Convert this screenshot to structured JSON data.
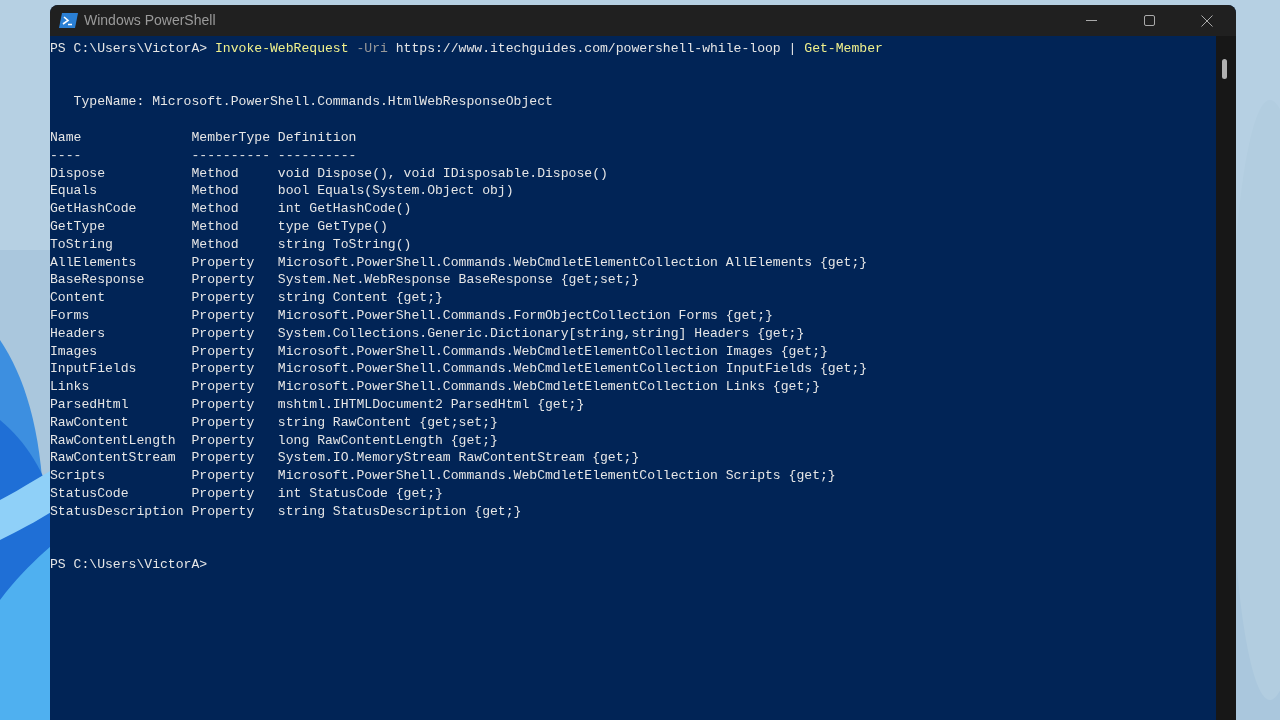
{
  "window": {
    "title": "Windows PowerShell"
  },
  "console": {
    "command": {
      "prompt": "PS C:\\Users\\VictorA>",
      "tokens": [
        {
          "kind": "cmdlet",
          "text": "Invoke-WebRequest"
        },
        {
          "kind": "parameter",
          "text": "-Uri"
        },
        {
          "kind": "argument",
          "text": "https://www.itechguides.com/powershell-while-loop"
        },
        {
          "kind": "operator",
          "text": "|"
        },
        {
          "kind": "cmdlet",
          "text": "Get-Member"
        }
      ]
    },
    "type_name": "TypeName: Microsoft.PowerShell.Commands.HtmlWebResponseObject",
    "table": {
      "columns": [
        "Name",
        "MemberType",
        "Definition"
      ],
      "underlines": [
        "----",
        "----------",
        "----------"
      ],
      "rows": [
        [
          "Dispose",
          "Method",
          "void Dispose(), void IDisposable.Dispose()"
        ],
        [
          "Equals",
          "Method",
          "bool Equals(System.Object obj)"
        ],
        [
          "GetHashCode",
          "Method",
          "int GetHashCode()"
        ],
        [
          "GetType",
          "Method",
          "type GetType()"
        ],
        [
          "ToString",
          "Method",
          "string ToString()"
        ],
        [
          "AllElements",
          "Property",
          "Microsoft.PowerShell.Commands.WebCmdletElementCollection AllElements {get;}"
        ],
        [
          "BaseResponse",
          "Property",
          "System.Net.WebResponse BaseResponse {get;set;}"
        ],
        [
          "Content",
          "Property",
          "string Content {get;}"
        ],
        [
          "Forms",
          "Property",
          "Microsoft.PowerShell.Commands.FormObjectCollection Forms {get;}"
        ],
        [
          "Headers",
          "Property",
          "System.Collections.Generic.Dictionary[string,string] Headers {get;}"
        ],
        [
          "Images",
          "Property",
          "Microsoft.PowerShell.Commands.WebCmdletElementCollection Images {get;}"
        ],
        [
          "InputFields",
          "Property",
          "Microsoft.PowerShell.Commands.WebCmdletElementCollection InputFields {get;}"
        ],
        [
          "Links",
          "Property",
          "Microsoft.PowerShell.Commands.WebCmdletElementCollection Links {get;}"
        ],
        [
          "ParsedHtml",
          "Property",
          "mshtml.IHTMLDocument2 ParsedHtml {get;}"
        ],
        [
          "RawContent",
          "Property",
          "string RawContent {get;set;}"
        ],
        [
          "RawContentLength",
          "Property",
          "long RawContentLength {get;}"
        ],
        [
          "RawContentStream",
          "Property",
          "System.IO.MemoryStream RawContentStream {get;}"
        ],
        [
          "Scripts",
          "Property",
          "Microsoft.PowerShell.Commands.WebCmdletElementCollection Scripts {get;}"
        ],
        [
          "StatusCode",
          "Property",
          "int StatusCode {get;}"
        ],
        [
          "StatusDescription",
          "Property",
          "string StatusDescription {get;}"
        ]
      ]
    },
    "prompt": "PS C:\\Users\\VictorA>"
  }
}
